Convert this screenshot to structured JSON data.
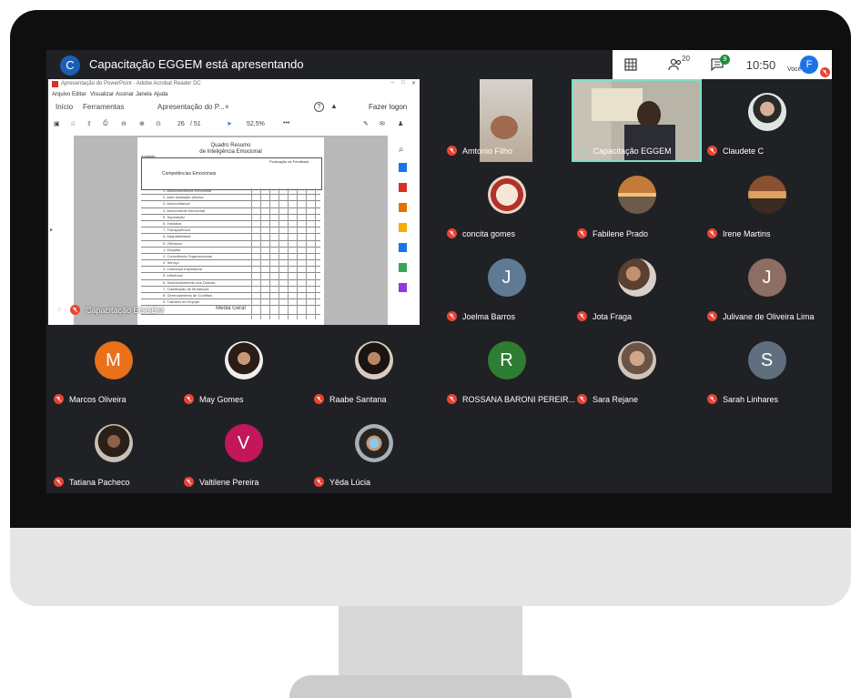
{
  "meeting": {
    "presenter_initial": "C",
    "presenting_text": "Capacitação EGGEM está apresentando",
    "participants_count": "20",
    "chat_badge": "9",
    "time": "10:50",
    "self_initial": "F",
    "self_label": "Você"
  },
  "shared_screen": {
    "presenter_label": "Capacitação EGGEM",
    "window_title": "Apresentação do PowerPoint - Adobe Acrobat Reader DC",
    "menu": [
      "Arquivo",
      "Editar",
      "Visualizar",
      "Assinar",
      "Janela",
      "Ajuda"
    ],
    "tabs": [
      "Início",
      "Ferramentas",
      "Apresentação do P..."
    ],
    "login": "Fazer logon",
    "page_current": "26",
    "page_total": "/ 51",
    "zoom": "52,5%",
    "doc_title_1": "Quadro Resumo",
    "doc_title_2": "de Inteligência Emocional",
    "doc_evaluated": "Avaliado:",
    "doc_header": "Competências Emocionais",
    "doc_feedback": "Pontuação de Feedback",
    "doc_rows": [
      "1. Autoconsciência Emocional",
      "2. Auto avaliação precisa",
      "3. Autoconfiança",
      "4. Autocontrole emocional",
      "5. Superação",
      "6. Iniciativa",
      "7. Transparência",
      "8. Adaptabilidade",
      "9. Otimismo",
      "1. Empatia",
      "2. Consciência Organizacional",
      "3. Serviço",
      "4. Liderança Inspiradora",
      "5. Influência",
      "6. Desenvolvimento dos Demais",
      "7. Catalisação de Mudanças",
      "8. Gerenciamento de Conflitos",
      "9. Trabalho em Equipe"
    ],
    "doc_footer": "Média Geral"
  },
  "participants": [
    {
      "name": "Amtonio Filho",
      "initial": "",
      "color": "#4a4a4a",
      "video": true
    },
    {
      "name": "Capacitação EGGEM",
      "initial": "",
      "color": "#4a4a4a",
      "video": true,
      "speaking": true
    },
    {
      "name": "Claudete C",
      "initial": "",
      "color": "#888888",
      "photo": true
    },
    {
      "name": "concita gomes",
      "initial": "",
      "color": "#c0392b",
      "photo": true
    },
    {
      "name": "Fabilene Prado",
      "initial": "",
      "color": "#c8884a",
      "photo": true
    },
    {
      "name": "Irene Martins",
      "initial": "",
      "color": "#b06a40",
      "photo": true
    },
    {
      "name": "Joelma Barros",
      "initial": "J",
      "color": "#5f7a94"
    },
    {
      "name": "Jota Fraga",
      "initial": "",
      "color": "#7a6655",
      "photo": true
    },
    {
      "name": "Julivane de Oliveira Lima",
      "initial": "J",
      "color": "#8d6e63"
    },
    {
      "name": "Marcos Oliveira",
      "initial": "M",
      "color": "#e8711a"
    },
    {
      "name": "May Gomes",
      "initial": "",
      "color": "#6a5040",
      "photo": true
    },
    {
      "name": "Raabe Santana",
      "initial": "",
      "color": "#6a5040",
      "photo": true
    },
    {
      "name": "ROSSANA BARONI PEREIR...",
      "initial": "R",
      "color": "#2e7d32"
    },
    {
      "name": "Sara Rejane",
      "initial": "",
      "color": "#9a7a68",
      "photo": true
    },
    {
      "name": "Sarah Linhares",
      "initial": "S",
      "color": "#5f6f7e"
    },
    {
      "name": "Tatiana Pacheco",
      "initial": "",
      "color": "#5a4a3a",
      "photo": true
    },
    {
      "name": "Valtilene Pereira",
      "initial": "V",
      "color": "#c2185b"
    },
    {
      "name": "Yêda Lúcia",
      "initial": "",
      "color": "#4a5a6a",
      "photo": true
    }
  ],
  "colors": {
    "background": "#202124",
    "muted_mic": "#ea4335",
    "active_border": "#7ee0c8",
    "brand_blue": "#1a5fb4"
  }
}
